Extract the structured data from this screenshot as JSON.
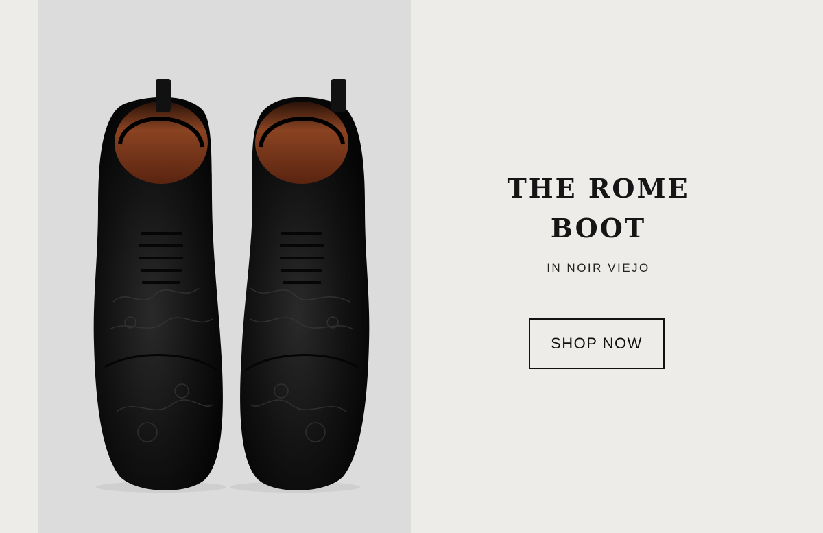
{
  "hero": {
    "title_line1": "THE ROME",
    "title_line2": "BOOT",
    "subtitle": "IN NOIR VIEJO",
    "cta_label": "SHOP NOW"
  },
  "colors": {
    "page_background": "#edece8",
    "product_background": "#dcdcdc",
    "boot_leather": "#111111",
    "boot_lining": "#7a3a1c",
    "text": "#151515"
  },
  "icons": {
    "product_image": "black-lace-up-boots-pair"
  }
}
